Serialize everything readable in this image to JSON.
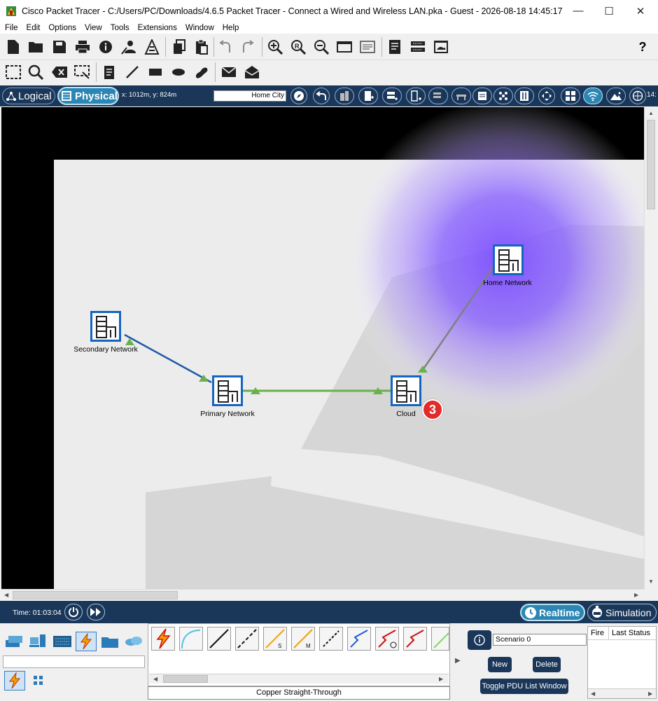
{
  "window": {
    "title": "Cisco Packet Tracer - C:/Users/PC/Downloads/4.6.5 Packet Tracer - Connect a Wired and Wireless LAN.pka - Guest - 2026-08-18 14:45:17",
    "minimize": "—",
    "maximize": "☐",
    "close": "✕"
  },
  "menu": [
    "File",
    "Edit",
    "Options",
    "View",
    "Tools",
    "Extensions",
    "Window",
    "Help"
  ],
  "toolbar_help": "?",
  "nav": {
    "logical_label": "Logical",
    "physical_label": "Physical",
    "coords": "x: 1012m, y: 824m",
    "location": "Home City",
    "extra": "14:"
  },
  "workspace": {
    "devices": [
      {
        "label": "Secondary Network"
      },
      {
        "label": "Primary Network"
      },
      {
        "label": "Cloud"
      },
      {
        "label": "Home Network"
      }
    ],
    "badge": "3",
    "colors": {
      "link_blue": "#1f5aa6",
      "link_green": "#6ab04c",
      "link_gray": "#808080",
      "wireless": "#7b4dff"
    }
  },
  "bottom": {
    "time": "Time: 01:03:04",
    "realtime": "Realtime",
    "simulation": "Simulation",
    "connection_name": "Copper Straight-Through",
    "conn_labels": {
      "s": "S",
      "m": "M"
    },
    "scenario": "Scenario 0",
    "new": "New",
    "delete": "Delete",
    "toggle_pdu": "Toggle PDU List Window",
    "col_fire": "Fire",
    "col_last_status": "Last Status"
  }
}
